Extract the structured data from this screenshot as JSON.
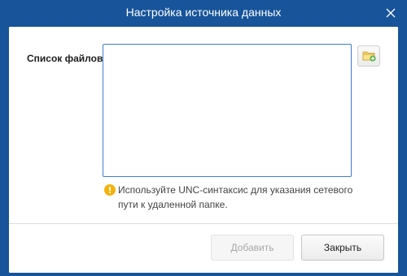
{
  "window": {
    "title": "Настройка источника данных",
    "close_icon": "close-icon"
  },
  "form": {
    "file_list_label": "Список файлов:",
    "file_list_items": [],
    "browse_icon": "folder-add-icon",
    "hint_icon": "warning-icon",
    "hint_line1": "Используйте UNC-синтаксис для указания сетевого",
    "hint_line2": "пути к удаленной папке."
  },
  "footer": {
    "add_label": "Добавить",
    "add_enabled": false,
    "close_label": "Закрыть"
  },
  "colors": {
    "window_frame": "#17549a",
    "list_border": "#3d7fd0",
    "hint_icon": "#f2b30d"
  }
}
